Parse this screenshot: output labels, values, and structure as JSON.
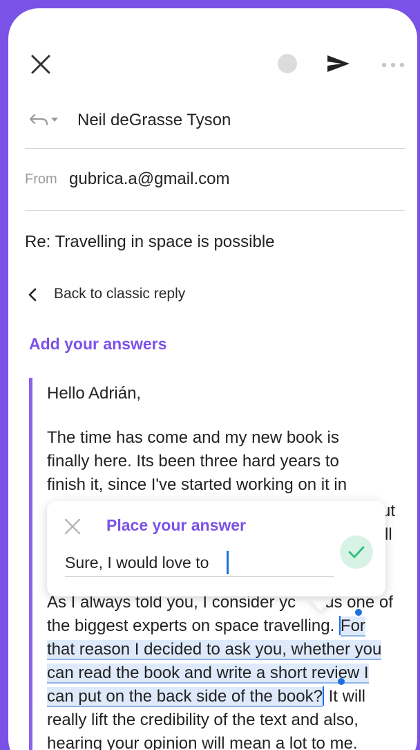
{
  "header": {
    "reply_recipient": "Neil deGrasse Tyson",
    "from_label": "From",
    "from_email": "gubrica.a@gmail.com",
    "subject": "Re: Travelling in space is possible"
  },
  "nav": {
    "back_label": "Back to classic reply"
  },
  "section": {
    "title": "Add your answers"
  },
  "email_body": {
    "greeting": "Hello Adrián,",
    "p1_line1": "The time has come and my new book is",
    "p1_line2": "finally here. Its been three hard years to",
    "p1_line3": "finish it, since I've started working on it in",
    "partial_right1": "ut",
    "partial_right2": "ll",
    "p2_line1": "As I always told you, I consider yc",
    "p2_line1_end": "us one of",
    "p2_line2_start": "the biggest experts on space travelling.",
    "p2_line2_sel": "For",
    "p2_line3_sel": "that reason I decided to ask you, whether you",
    "p2_line4_sel": "can read the book and write a short review I",
    "p2_line5_sel": "can put on the back side of the book?",
    "p2_line5_end": "It will",
    "p2_line6": "really lift the credibility of the text and also,",
    "p2_line7": "hearing your opinion will mean a lot to me."
  },
  "popup": {
    "title": "Place your answer",
    "answer_value": "Sure, I would love to"
  },
  "colors": {
    "accent": "#7b52e8",
    "selection": "#deeafb",
    "caret": "#1e6fe0",
    "confirm": "#2fbf7f"
  },
  "icons": [
    "close-icon",
    "status-dot-icon",
    "send-icon",
    "more-icon",
    "reply-icon",
    "chevron-down-icon",
    "chevron-left-icon",
    "check-icon"
  ]
}
